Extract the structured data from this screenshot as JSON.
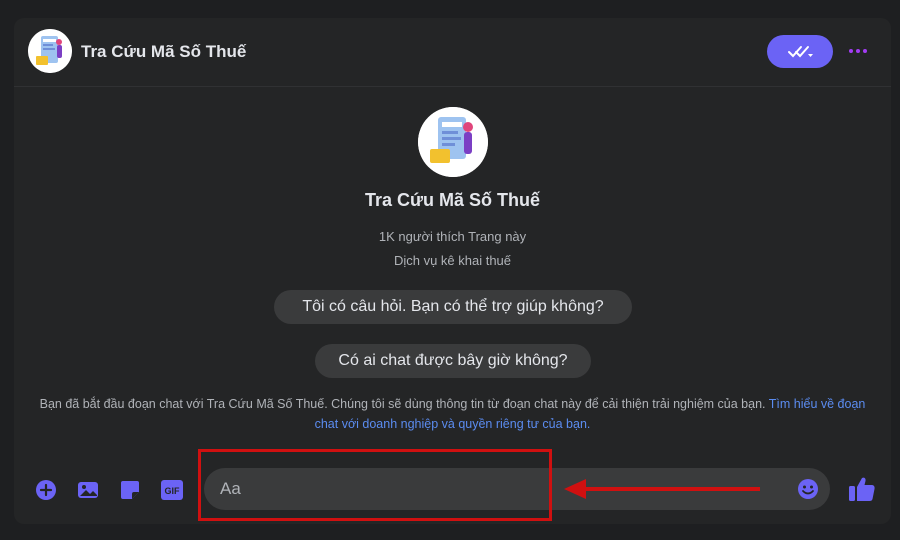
{
  "header": {
    "title": "Tra Cứu Mã Số Thuế",
    "icons": [
      "page-avatar",
      "check-dropdown-icon",
      "more-options-icon"
    ]
  },
  "intro": {
    "page_name": "Tra Cứu Mã Số Thuế",
    "likes": "1K người thích Trang này",
    "category": "Dịch vụ kê khai thuế"
  },
  "suggestions": [
    "Tôi có câu hỏi. Bạn có thể trợ giúp không?",
    "Có ai chat được bây giờ không?"
  ],
  "notice": {
    "text": "Bạn đã bắt đầu đoạn chat với Tra Cứu Mã Số Thuế. Chúng tôi sẽ dùng thông tin từ đoạn chat này để cải thiện trải nghiệm của bạn.",
    "link": "Tìm hiểu về đoạn chat với doanh nghiệp và quyền riêng tư của bạn."
  },
  "composer": {
    "placeholder": "Aa",
    "icons": [
      "plus-icon",
      "image-icon",
      "sticker-icon",
      "gif-icon",
      "emoji-icon",
      "like-icon"
    ],
    "gif_label": "GIF"
  },
  "colors": {
    "background": "#1e1f21",
    "panel": "#242526",
    "bubble": "#3a3b3c",
    "accent": "#6b63f5",
    "more": "#a33cf4",
    "link": "#5b8cf0",
    "highlight": "#d01010"
  }
}
